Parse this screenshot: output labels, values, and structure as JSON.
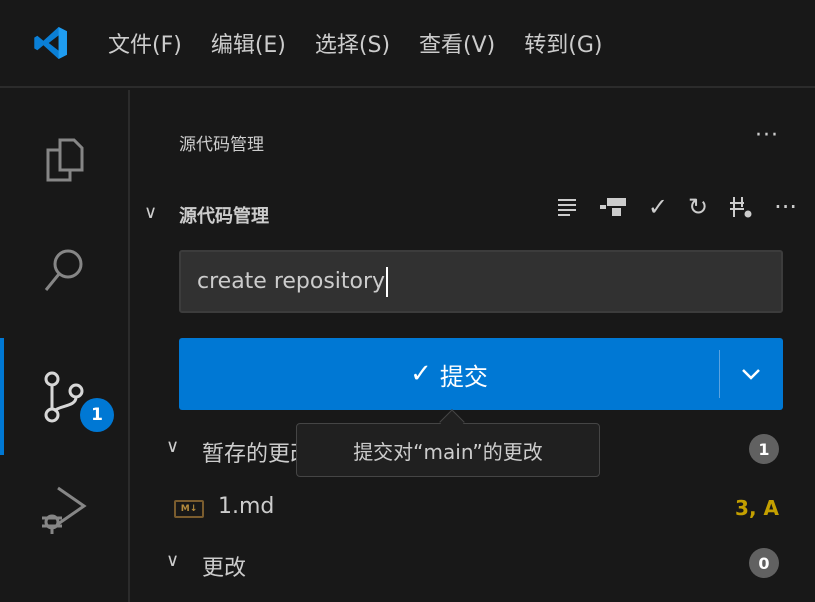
{
  "menu": [
    "文件(F)",
    "编辑(E)",
    "选择(S)",
    "查看(V)",
    "转到(G)"
  ],
  "activity": {
    "scm_badge": "1"
  },
  "panel": {
    "title": "源代码管理",
    "more": "···",
    "section_title": "源代码管理",
    "section_more": "···"
  },
  "commit": {
    "message": "create repository",
    "button_label": "提交",
    "tooltip": "提交对“main”的更改"
  },
  "staged": {
    "label": "暂存的更改",
    "count": "1",
    "files": [
      {
        "name": "1.md",
        "status": "3, A",
        "icon_text": "M↓"
      }
    ]
  },
  "changes": {
    "label": "更改",
    "count": "0"
  },
  "colors": {
    "accent": "#0078d4",
    "modified": "#c4a000",
    "background": "#181818"
  }
}
